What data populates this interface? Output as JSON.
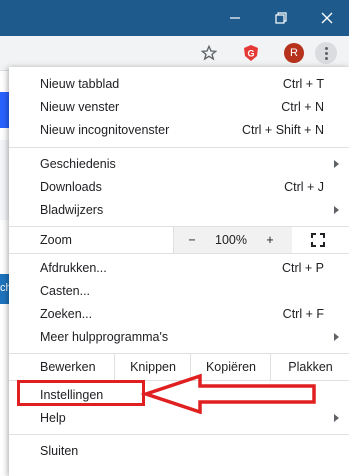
{
  "window": {
    "minimize_icon": "minimize-icon",
    "restore_icon": "restore-icon",
    "close_icon": "close-icon"
  },
  "toolbar": {
    "bookmark_icon": "star-icon",
    "extension_badge": "G",
    "avatar_initial": "R",
    "more_icon": "more-vertical-icon"
  },
  "page": {
    "side_text": "ch"
  },
  "menu": {
    "new_tab": {
      "label": "Nieuw tabblad",
      "shortcut": "Ctrl + T"
    },
    "new_window": {
      "label": "Nieuw venster",
      "shortcut": "Ctrl + N"
    },
    "new_incognito": {
      "label": "Nieuw incognitovenster",
      "shortcut": "Ctrl + Shift + N"
    },
    "history": {
      "label": "Geschiedenis"
    },
    "downloads": {
      "label": "Downloads",
      "shortcut": "Ctrl + J"
    },
    "bookmarks": {
      "label": "Bladwijzers"
    },
    "zoom": {
      "label": "Zoom",
      "minus": "−",
      "value": "100%",
      "plus": "+"
    },
    "print": {
      "label": "Afdrukken...",
      "shortcut": "Ctrl + P"
    },
    "cast": {
      "label": "Casten..."
    },
    "find": {
      "label": "Zoeken...",
      "shortcut": "Ctrl + F"
    },
    "more_tools": {
      "label": "Meer hulpprogramma's"
    },
    "edit": {
      "label": "Bewerken",
      "cut": "Knippen",
      "copy": "Kopiëren",
      "paste": "Plakken"
    },
    "settings": {
      "label": "Instellingen"
    },
    "help": {
      "label": "Help"
    },
    "exit": {
      "label": "Sluiten"
    }
  },
  "colors": {
    "titlebar": "#1f5a8c",
    "annotation": "#e02020",
    "avatar": "#b7321c"
  }
}
